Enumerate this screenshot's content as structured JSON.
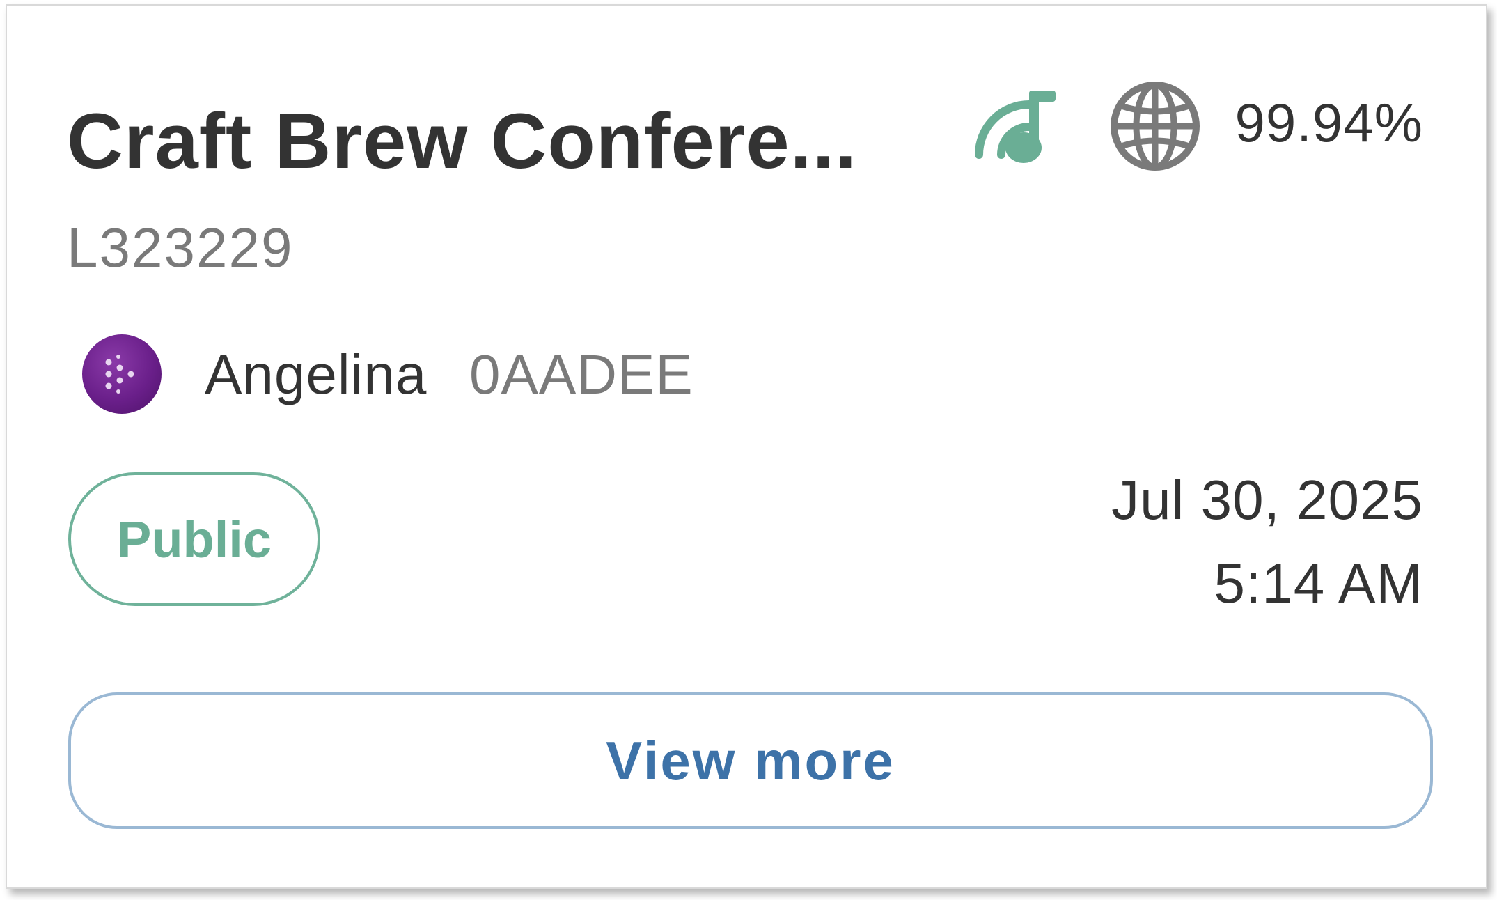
{
  "card": {
    "title": "Craft Brew Confere...",
    "code": "L323229",
    "icons": {
      "music": "music-broadcast-icon",
      "globe": "globe-icon"
    },
    "percentage": "99.94%",
    "user": {
      "name": "Angelina",
      "id": "0AADEE",
      "avatar_icon": "brand-logo-icon"
    },
    "visibility_badge": "Public",
    "date": "Jul 30, 2025",
    "time": "5:14 AM",
    "view_more_label": "View more"
  },
  "colors": {
    "accent_green": "#6aae95",
    "link_blue": "#3d72a8",
    "avatar_purple": "#6a1f8a",
    "text_dark": "#333333",
    "text_muted": "#7a7a7a"
  }
}
